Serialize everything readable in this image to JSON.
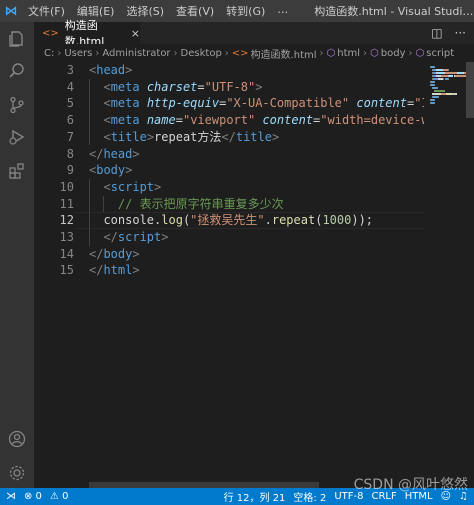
{
  "titlebar": {
    "menu": [
      "文件(F)",
      "编辑(E)",
      "选择(S)",
      "查看(V)",
      "转到(G)",
      "…"
    ],
    "window_title": "构造函数.html - Visual Studi…"
  },
  "tab": {
    "label": "构造函数.html",
    "close": "×"
  },
  "breadcrumb": [
    "C:",
    "Users",
    "Administrator",
    "Desktop",
    "构造函数.html",
    "html",
    "body",
    "script"
  ],
  "editor": {
    "line_numbers": [
      "3",
      "4",
      "5",
      "6",
      "7",
      "8",
      "9",
      "10",
      "11",
      "12",
      "13",
      "14",
      "15"
    ],
    "active_line": "12",
    "lines": [
      {
        "indent": "",
        "tokens": [
          [
            "br",
            "<"
          ],
          [
            "tag",
            "head"
          ],
          [
            "br",
            ">"
          ]
        ]
      },
      {
        "indent": "  ",
        "tokens": [
          [
            "br",
            "<"
          ],
          [
            "tag",
            "meta"
          ],
          [
            "txt",
            " "
          ],
          [
            "attr",
            "charset"
          ],
          [
            "txt",
            "="
          ],
          [
            "str",
            "\"UTF-8\""
          ],
          [
            "br",
            ">"
          ]
        ]
      },
      {
        "indent": "  ",
        "tokens": [
          [
            "br",
            "<"
          ],
          [
            "tag",
            "meta"
          ],
          [
            "txt",
            " "
          ],
          [
            "attr",
            "http-equiv"
          ],
          [
            "txt",
            "="
          ],
          [
            "str",
            "\"X-UA-Compatible\""
          ],
          [
            "txt",
            " "
          ],
          [
            "attr",
            "content"
          ],
          [
            "txt",
            "="
          ],
          [
            "str",
            "\"IE=edge\""
          ]
        ]
      },
      {
        "indent": "  ",
        "tokens": [
          [
            "br",
            "<"
          ],
          [
            "tag",
            "meta"
          ],
          [
            "txt",
            " "
          ],
          [
            "attr",
            "name"
          ],
          [
            "txt",
            "="
          ],
          [
            "str",
            "\"viewport\""
          ],
          [
            "txt",
            " "
          ],
          [
            "attr",
            "content"
          ],
          [
            "txt",
            "="
          ],
          [
            "str",
            "\"width=device-width"
          ]
        ]
      },
      {
        "indent": "  ",
        "tokens": [
          [
            "br",
            "<"
          ],
          [
            "tag",
            "title"
          ],
          [
            "br",
            ">"
          ],
          [
            "txt",
            "repeat方法"
          ],
          [
            "br",
            "</"
          ],
          [
            "tag",
            "title"
          ],
          [
            "br",
            ">"
          ]
        ]
      },
      {
        "indent": "",
        "tokens": [
          [
            "br",
            "</"
          ],
          [
            "tag",
            "head"
          ],
          [
            "br",
            ">"
          ]
        ]
      },
      {
        "indent": "",
        "tokens": [
          [
            "br",
            "<"
          ],
          [
            "tag",
            "body"
          ],
          [
            "br",
            ">"
          ]
        ]
      },
      {
        "indent": "  ",
        "tokens": [
          [
            "br",
            "<"
          ],
          [
            "tag",
            "script"
          ],
          [
            "br",
            ">"
          ]
        ]
      },
      {
        "indent": "    ",
        "tokens": [
          [
            "cmt",
            "// 表示把原字符串重复多少次"
          ]
        ]
      },
      {
        "indent": "  ",
        "tokens": [
          [
            "txt",
            "console."
          ],
          [
            "fn",
            "log"
          ],
          [
            "txt",
            "("
          ],
          [
            "str",
            "\"拯救吴先生\""
          ],
          [
            "txt",
            "."
          ],
          [
            "fn",
            "repeat"
          ],
          [
            "txt",
            "("
          ],
          [
            "num",
            "1000"
          ],
          [
            "txt",
            "));"
          ]
        ]
      },
      {
        "indent": "  ",
        "tokens": [
          [
            "br",
            "</"
          ],
          [
            "tag",
            "script"
          ],
          [
            "br",
            ">"
          ]
        ]
      },
      {
        "indent": "",
        "tokens": [
          [
            "br",
            "</"
          ],
          [
            "tag",
            "body"
          ],
          [
            "br",
            ">"
          ]
        ]
      },
      {
        "indent": "",
        "tokens": [
          [
            "br",
            "</"
          ],
          [
            "tag",
            "html"
          ],
          [
            "br",
            ">"
          ]
        ]
      }
    ]
  },
  "statusbar": {
    "errors": "⊗ 0",
    "warnings": "⚠ 0",
    "position": "行 12，列 21",
    "spaces": "空格: 2",
    "encoding": "UTF-8",
    "eol": "CRLF",
    "language": "HTML"
  },
  "watermark": "CSDN @风叶悠然",
  "activity_badge": "1",
  "colors": {
    "status": "#007acc",
    "editor_bg": "#1e1e1e",
    "tag": "#569cd6",
    "string": "#ce9178"
  }
}
